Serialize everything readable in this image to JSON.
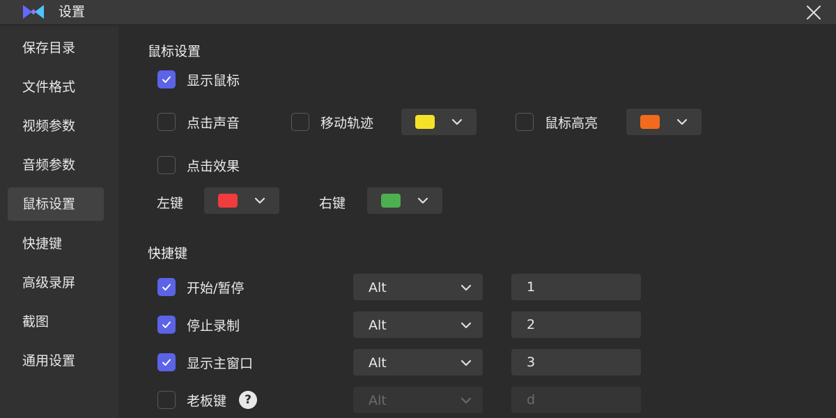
{
  "window": {
    "title": "设置"
  },
  "sidebar": {
    "items": [
      {
        "label": "保存目录"
      },
      {
        "label": "文件格式"
      },
      {
        "label": "视频参数"
      },
      {
        "label": "音频参数"
      },
      {
        "label": "鼠标设置",
        "active": true
      },
      {
        "label": "快捷键"
      },
      {
        "label": "高级录屏"
      },
      {
        "label": "截图"
      },
      {
        "label": "通用设置"
      }
    ]
  },
  "mouse": {
    "section_title": "鼠标设置",
    "show_cursor": {
      "label": "显示鼠标",
      "checked": true
    },
    "click_sound": {
      "label": "点击声音",
      "checked": false
    },
    "move_track": {
      "label": "移动轨迹",
      "checked": false,
      "color": "#f5e228"
    },
    "highlight": {
      "label": "鼠标高亮",
      "checked": false,
      "color": "#f26b1d"
    },
    "click_effect": {
      "label": "点击效果",
      "checked": false
    },
    "left_key": {
      "label": "左键",
      "color": "#f03c3c"
    },
    "right_key": {
      "label": "右键",
      "color": "#4caf50"
    }
  },
  "hotkeys": {
    "section_title": "快捷键",
    "rows": [
      {
        "label": "开始/暂停",
        "checked": true,
        "modifier": "Alt",
        "key": "1"
      },
      {
        "label": "停止录制",
        "checked": true,
        "modifier": "Alt",
        "key": "2"
      },
      {
        "label": "显示主窗口",
        "checked": true,
        "modifier": "Alt",
        "key": "3"
      },
      {
        "label": "老板键",
        "checked": false,
        "modifier": "Alt",
        "key": "d"
      }
    ],
    "help_glyph": "?"
  },
  "colors": {
    "accent": "#5b63e6",
    "background": "#2b2b2b",
    "sidebar": "#313131",
    "titlebar": "#3a3a3a"
  }
}
